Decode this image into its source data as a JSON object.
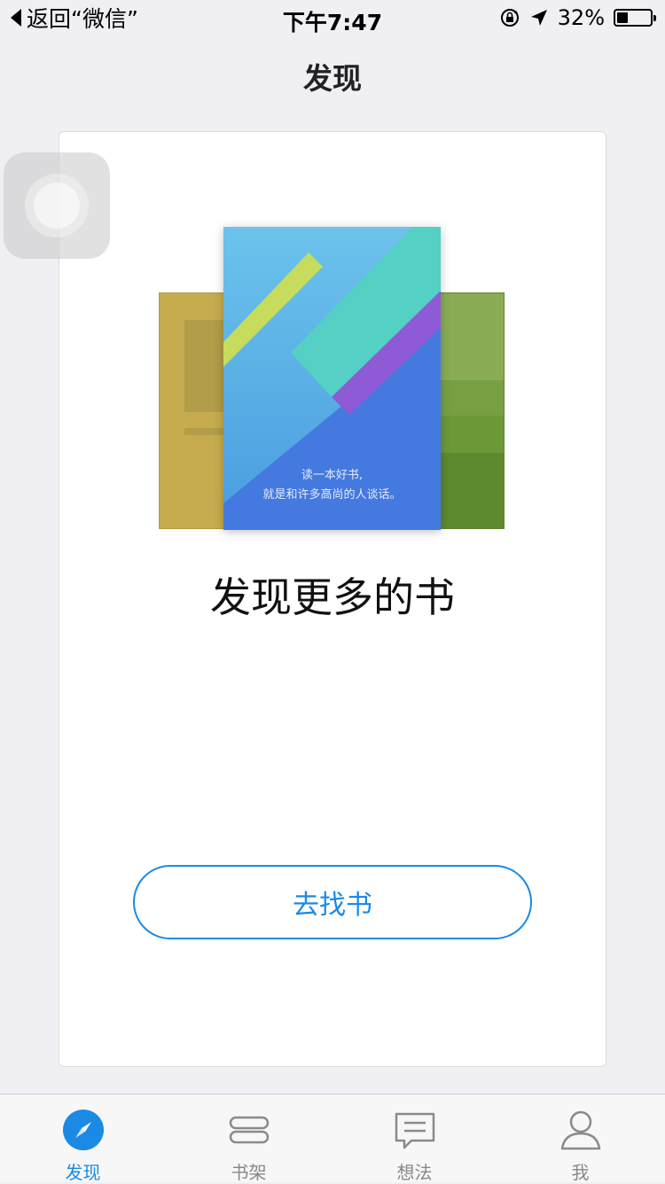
{
  "status_bar": {
    "back_label": "返回“微信”",
    "time": "下午7:47",
    "battery_percent": "32%",
    "battery_level": 0.32
  },
  "nav": {
    "title": "发现"
  },
  "book_cover": {
    "quote_line1": "读一本好书,",
    "quote_line2": "就是和许多高尚的人谈话。"
  },
  "main": {
    "headline": "发现更多的书",
    "find_button": "去找书"
  },
  "tabs": [
    {
      "label": "发现",
      "icon": "compass-icon",
      "active": true
    },
    {
      "label": "书架",
      "icon": "bookshelf-icon",
      "active": false
    },
    {
      "label": "想法",
      "icon": "comment-icon",
      "active": false
    },
    {
      "label": "我",
      "icon": "person-icon",
      "active": false
    }
  ],
  "colors": {
    "accent": "#1a8ae5",
    "background": "#efeff4",
    "tab_inactive": "#888888"
  }
}
